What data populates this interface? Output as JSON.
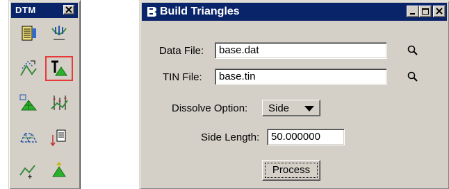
{
  "palette": {
    "title": "DTM",
    "tools": [
      {
        "name": "load-dtm-features-icon"
      },
      {
        "name": "edit-dtm-features-icon"
      },
      {
        "name": "change-feature-type-icon"
      },
      {
        "name": "build-triangles-icon",
        "selected": true
      },
      {
        "name": "display-triangles-icon"
      },
      {
        "name": "display-contours-icon"
      },
      {
        "name": "triangle-edit-icon"
      },
      {
        "name": "export-dtm-icon"
      },
      {
        "name": "analyze-elevation-icon"
      },
      {
        "name": "drape-surface-icon"
      }
    ]
  },
  "dialog": {
    "title": "Build Triangles",
    "data_file_label": "Data File:",
    "data_file_value": "base.dat",
    "tin_file_label": "TIN File:",
    "tin_file_value": "base.tin",
    "dissolve_label": "Dissolve Option:",
    "dissolve_value": "Side",
    "side_length_label": "Side Length:",
    "side_length_value": "50.000000",
    "process_label": "Process"
  },
  "colors": {
    "title_bar": "#0a246a",
    "face": "#d4d0c8",
    "highlight": "#e8393a"
  }
}
